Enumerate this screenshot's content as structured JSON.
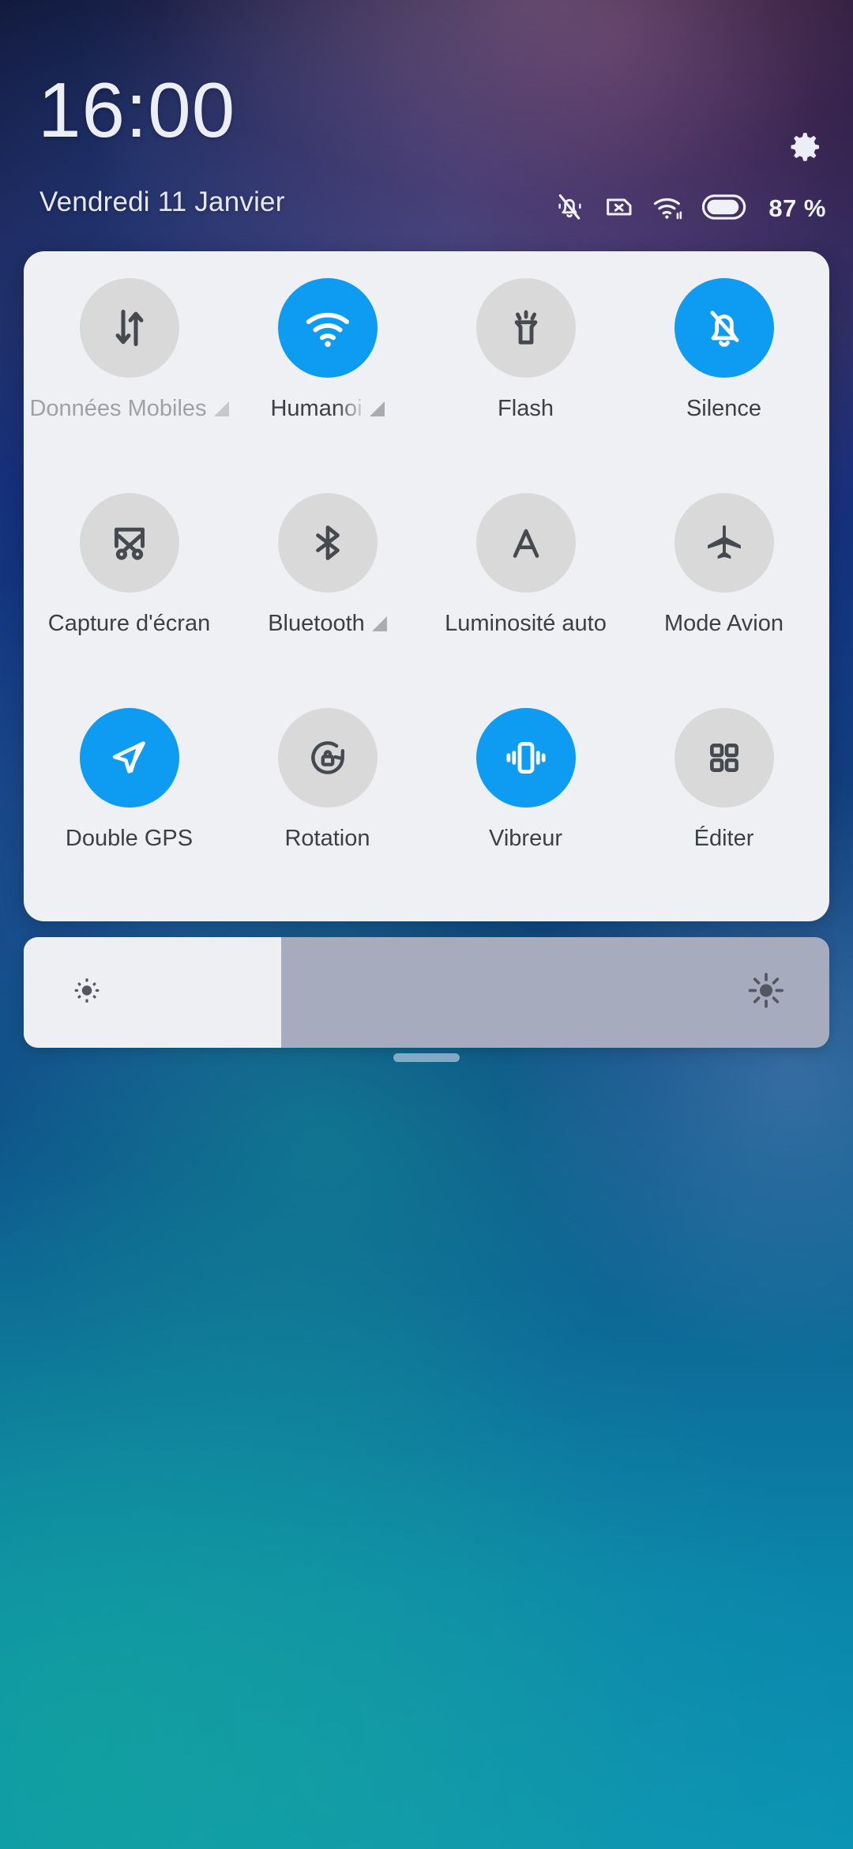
{
  "theme": {
    "accent": "#0d9cf2",
    "tile_off_bg": "#d9d9d9",
    "panel_bg": "#eef0f3",
    "label_color": "#3c3f44",
    "label_dim_color": "#9ea1a6"
  },
  "header": {
    "time": "16:00",
    "date": "Vendredi 11 Janvier",
    "settings_icon": "gear-icon",
    "status_icons": [
      {
        "name": "bell-muted-icon"
      },
      {
        "name": "sim-card-missing-icon"
      },
      {
        "name": "wifi-signal-icon"
      },
      {
        "name": "battery-icon"
      }
    ],
    "battery_percent": "87 %"
  },
  "quick_settings": {
    "tiles": [
      {
        "label": "Données Mobiles",
        "icon": "mobile-data-icon",
        "state": "off",
        "dim": true,
        "expandable": true,
        "truncated": false
      },
      {
        "label": "Humanoi",
        "icon": "wifi-icon",
        "state": "on",
        "dim": false,
        "expandable": true,
        "truncated": true
      },
      {
        "label": "Flash",
        "icon": "flashlight-icon",
        "state": "off",
        "dim": false,
        "expandable": false,
        "truncated": false
      },
      {
        "label": "Silence",
        "icon": "bell-muted-icon",
        "state": "on",
        "dim": false,
        "expandable": false,
        "truncated": false
      },
      {
        "label": "Capture d'écran",
        "icon": "screenshot-icon",
        "state": "off",
        "dim": false,
        "expandable": false,
        "truncated": false
      },
      {
        "label": "Bluetooth",
        "icon": "bluetooth-icon",
        "state": "off",
        "dim": false,
        "expandable": true,
        "truncated": false
      },
      {
        "label": "Luminosité auto",
        "icon": "auto-brightness-icon",
        "state": "off",
        "dim": false,
        "expandable": false,
        "truncated": false
      },
      {
        "label": "Mode Avion",
        "icon": "airplane-icon",
        "state": "off",
        "dim": false,
        "expandable": false,
        "truncated": false
      },
      {
        "label": "Double GPS",
        "icon": "location-arrow-icon",
        "state": "on",
        "dim": false,
        "expandable": false,
        "truncated": false
      },
      {
        "label": "Rotation",
        "icon": "rotation-lock-icon",
        "state": "off",
        "dim": false,
        "expandable": false,
        "truncated": false
      },
      {
        "label": "Vibreur",
        "icon": "vibrate-icon",
        "state": "on",
        "dim": false,
        "expandable": false,
        "truncated": false
      },
      {
        "label": "Éditer",
        "icon": "grid-edit-icon",
        "state": "off",
        "dim": false,
        "expandable": false,
        "truncated": false
      }
    ]
  },
  "brightness_slider": {
    "value_percent": 32,
    "low_icon": "brightness-low-icon",
    "high_icon": "brightness-high-icon"
  },
  "drag_handle": {
    "name": "panel-drag-handle"
  }
}
